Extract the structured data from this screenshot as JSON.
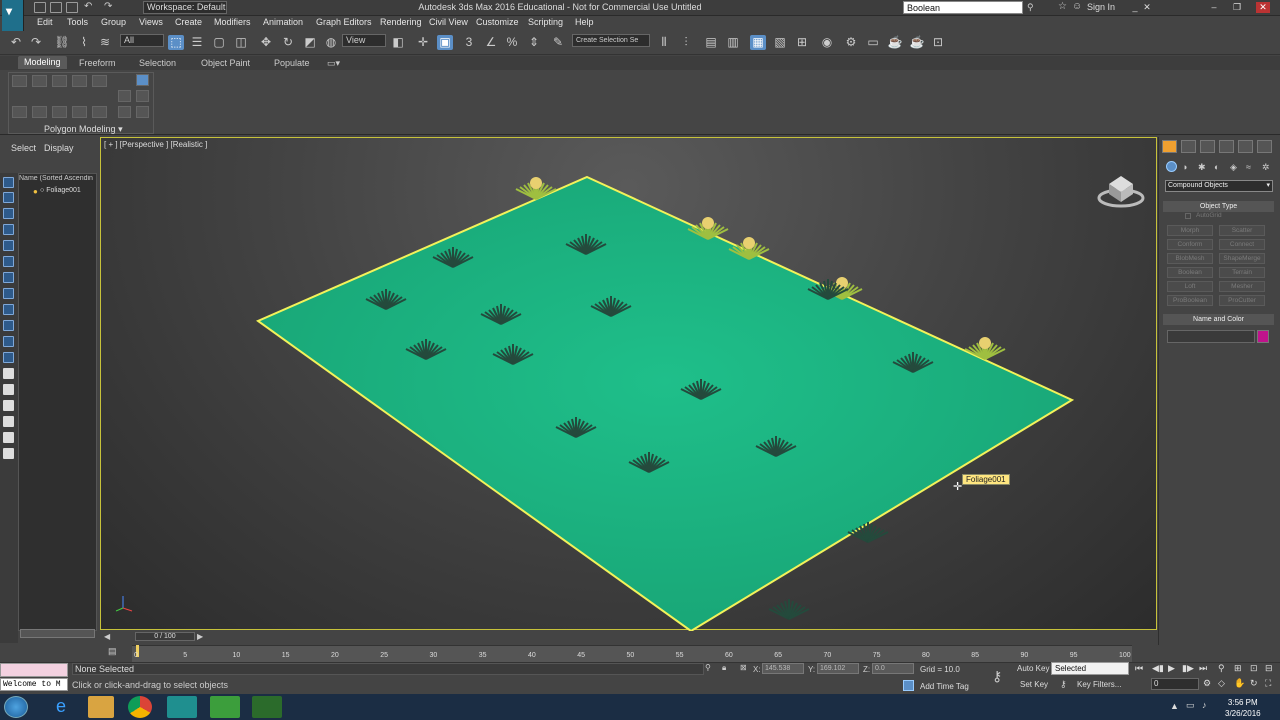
{
  "window": {
    "title": "Autodesk 3ds Max 2016 Educational - Not for Commercial Use   Untitled",
    "workspace": "Workspace: Default",
    "search_value": "Boolean",
    "sign_in": "Sign In"
  },
  "menu": [
    "Edit",
    "Tools",
    "Group",
    "Views",
    "Create",
    "Modifiers",
    "Animation",
    "Graph Editors",
    "Rendering",
    "Civil View",
    "Customize",
    "Scripting",
    "Help"
  ],
  "toolbar": {
    "selection_filter": "All",
    "ref_coord": "View",
    "named_selection": "Create Selection Se"
  },
  "ribbon": {
    "tabs": [
      "Modeling",
      "Freeform",
      "Selection",
      "Object Paint",
      "Populate"
    ],
    "panel_label": "Polygon Modeling"
  },
  "scene_explorer": {
    "tabs": [
      "Select",
      "Display"
    ],
    "column_header": "Name (Sorted Ascendin",
    "items": [
      "Foliage001"
    ]
  },
  "viewport": {
    "label": "[ + ] [Perspective ] [Realistic ]",
    "tooltip": "Foliage001"
  },
  "command_panel": {
    "category": "Compound Objects",
    "object_type_title": "Object Type",
    "autogrid": "AutoGrid",
    "buttons": [
      "Morph",
      "Scatter",
      "Conform",
      "Connect",
      "BlobMesh",
      "ShapeMerge",
      "Boolean",
      "Terrain",
      "Loft",
      "Mesher",
      "ProBoolean",
      "ProCutter"
    ],
    "name_color_title": "Name and Color",
    "color": "#c0138c"
  },
  "timeline": {
    "frame": "0 / 100",
    "ticks": [
      "0",
      "5",
      "10",
      "15",
      "20",
      "25",
      "30",
      "35",
      "40",
      "45",
      "50",
      "55",
      "60",
      "65",
      "70",
      "75",
      "80",
      "85",
      "90",
      "95",
      "100"
    ]
  },
  "status": {
    "selection": "None Selected",
    "prompt": "Click or click-and-drag to select objects",
    "maxscript": "Welcome to M",
    "x_label": "X:",
    "x_value": "145.538",
    "y_label": "Y:",
    "y_value": "169.102",
    "z_label": "Z:",
    "z_value": "0.0",
    "grid": "Grid = 10.0",
    "add_time_tag": "Add Time Tag",
    "auto_key": "Auto Key",
    "selected": "Selected",
    "set_key": "Set Key",
    "key_filters": "Key Filters...",
    "frame_field": "0"
  },
  "taskbar": {
    "time": "3:56 PM",
    "date": "3/26/2016"
  }
}
